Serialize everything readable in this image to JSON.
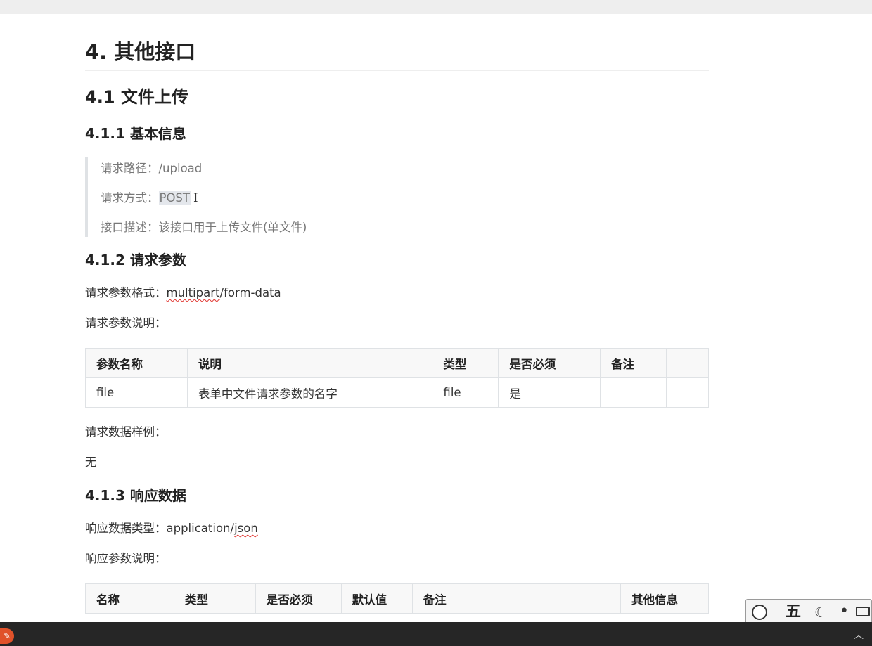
{
  "section": {
    "title": "4. 其他接口",
    "subsection_title": "4.1 文件上传"
  },
  "basic_info": {
    "heading": "4.1.1 基本信息",
    "path_label": "请求路径：",
    "path_value": "/upload",
    "method_label": "请求方式：",
    "method_value": "POST",
    "desc_label": "接口描述：",
    "desc_value": "该接口用于上传文件(单文件)"
  },
  "request_params": {
    "heading": "4.1.2 请求参数",
    "format_label": "请求参数格式：",
    "format_value_marked": "multipart",
    "format_value_rest": "/form-data",
    "desc_label": "请求参数说明：",
    "table": {
      "headers": [
        "参数名称",
        "说明",
        "类型",
        "是否必须",
        "备注",
        ""
      ],
      "rows": [
        [
          "file",
          "表单中文件请求参数的名字",
          "file",
          "是",
          "",
          ""
        ]
      ]
    },
    "sample_label": "请求数据样例：",
    "sample_value": "无"
  },
  "response_data": {
    "heading": "4.1.3 响应数据",
    "type_label": "响应数据类型：",
    "type_value_plain": "application/",
    "type_value_marked": "json",
    "desc_label": "响应参数说明：",
    "table": {
      "headers": [
        "名称",
        "类型",
        "是否必须",
        "默认值",
        "备注",
        "其他信息"
      ]
    }
  },
  "ime_toolbar": {
    "logo_icon": "sogou-logo-icon",
    "mode": "五",
    "moon_icon": "☾",
    "dot_icon": "•",
    "keyboard_icon": "keyboard-icon"
  },
  "taskbar": {
    "app_icon": "✎",
    "tray_arrow": "︿"
  },
  "colors": {
    "heading": "#222222",
    "body_text": "#333333",
    "quote_text": "#777777",
    "quote_border": "#dfe2e5",
    "table_border": "#dfe2e5",
    "table_header_bg": "#f8f8f8",
    "highlight_bg": "#e4e7ec",
    "spellcheck": "#e0342f",
    "taskbar_bg": "#262626"
  }
}
